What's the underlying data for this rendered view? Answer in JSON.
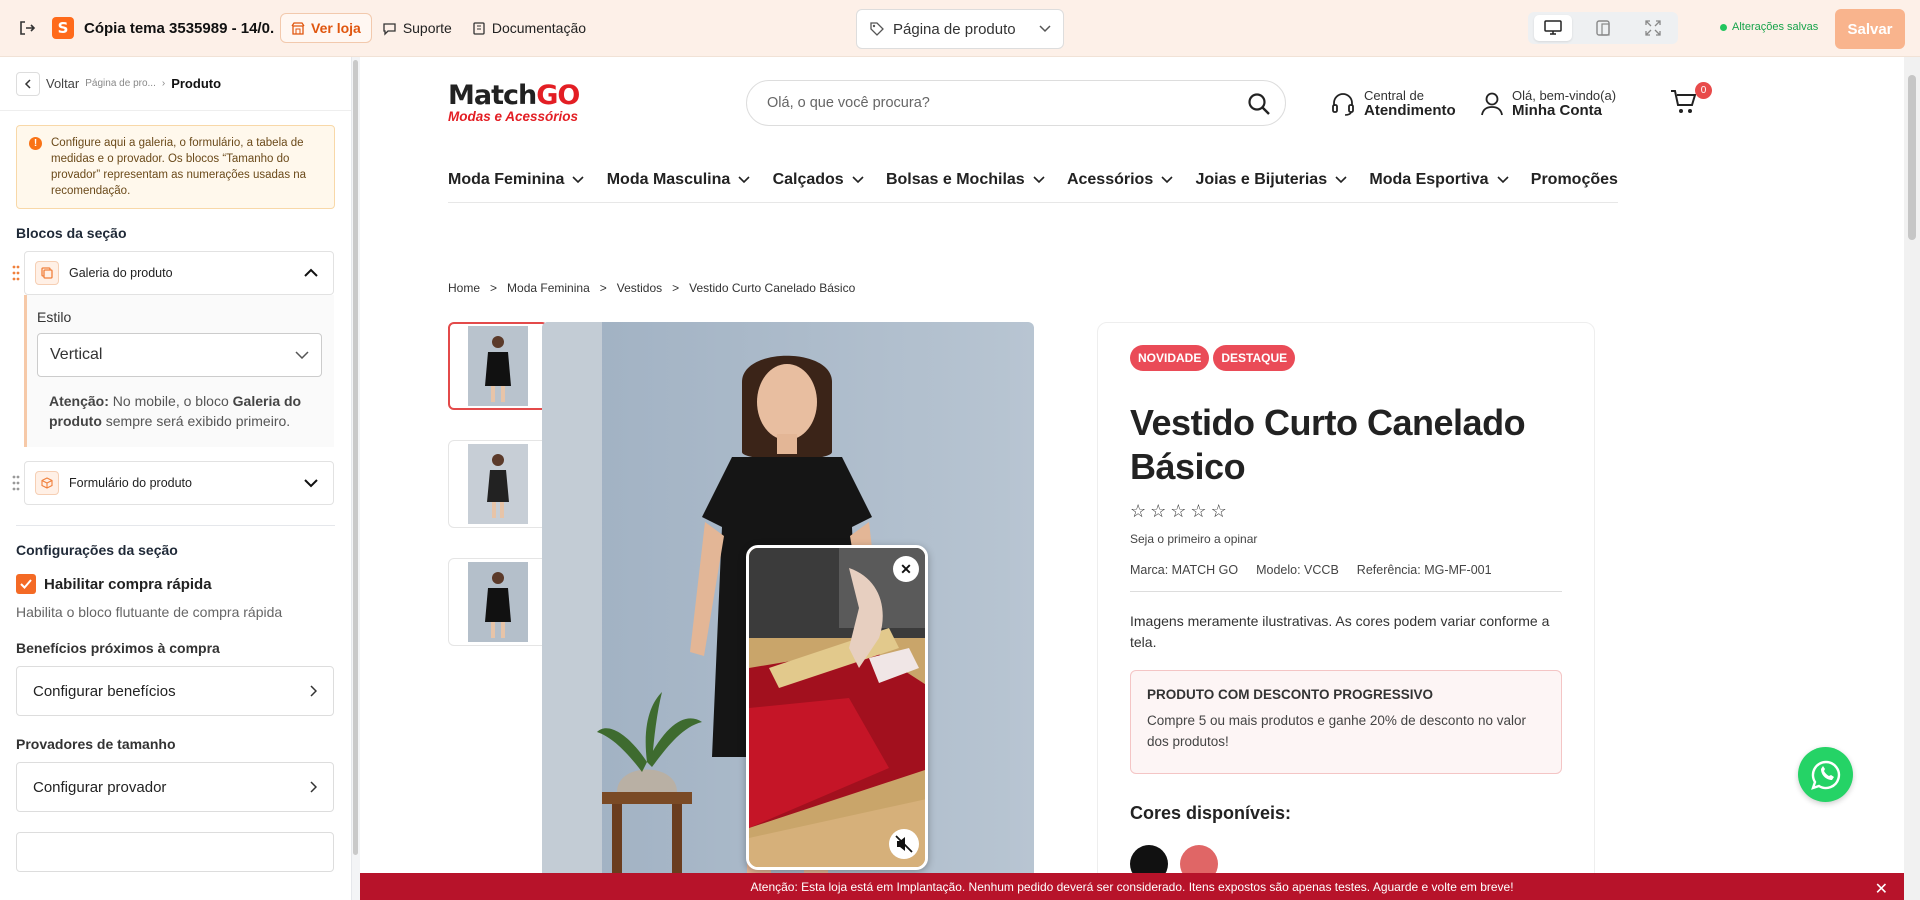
{
  "topbar": {
    "title": "Cópia tema 3535989 - 14/0...",
    "view_store": "Ver loja",
    "support": "Suporte",
    "docs": "Documentação",
    "page_select": "Página de produto",
    "saved_status": "Alterações salvas",
    "save_button": "Salvar",
    "accent_color": "#ff6a1a"
  },
  "sidebar": {
    "back": "Voltar",
    "crumb_parent": "Página de pro...",
    "crumb_sep": "›",
    "crumb_current": "Produto",
    "notice": "Configure aqui a galeria, o formulário, a tabela de medidas e o provador. Os blocos “Tamanho do provador” representam as numerações usadas na recomendação.",
    "blocks_heading": "Blocos da seção",
    "block_gallery": "Galeria do produto",
    "style_label": "Estilo",
    "style_value": "Vertical",
    "note_prefix": "Atenção:",
    "note_text1": " No mobile, o bloco ",
    "note_bold": "Galeria do produto",
    "note_text2": " sempre será exibido primeiro.",
    "block_form": "Formulário do produto",
    "config_heading": "Configurações da seção",
    "quick_buy_label": "Habilitar compra rápida",
    "quick_buy_checked": true,
    "quick_buy_help": "Habilita o bloco flutuante de compra rápida",
    "benefits_heading": "Benefícios próximos à compra",
    "benefits_button": "Configurar benefícios",
    "fitters_heading": "Provadores de tamanho",
    "fitters_button": "Configurar provador"
  },
  "store": {
    "logo_match": "Match",
    "logo_go": "GO",
    "logo_sub": "Modas e Acessórios",
    "search_placeholder": "Olá, o que você procura?",
    "support_line1": "Central de",
    "support_line2": "Atendimento",
    "account_line1": "Olá, bem-vindo(a)",
    "account_line2": "Minha Conta",
    "cart_count": "0",
    "nav": [
      "Moda Feminina",
      "Moda Masculina",
      "Calçados",
      "Bolsas e Mochilas",
      "Acessórios",
      "Joias e Bijuterias",
      "Moda Esportiva",
      "Promoções"
    ],
    "breadcrumb": [
      "Home",
      ">",
      "Moda Feminina",
      ">",
      "Vestidos",
      ">",
      "Vestido Curto Canelado Básico"
    ],
    "tags": [
      "NOVIDADE",
      "DESTAQUE"
    ],
    "product_title": "Vestido Curto Canelado Básico",
    "rating_stars": 0,
    "first_review": "Seja o primeiro a opinar",
    "brand": "Marca: MATCH GO",
    "model": "Modelo: VCCB",
    "reference": "Referência: MG-MF-001",
    "disclaimer": "Imagens meramente ilustrativas. As cores podem variar conforme a tela.",
    "promo_title": "PRODUTO COM DESCONTO PROGRESSIVO",
    "promo_text": "Compre 5 ou mais produtos e ganhe 20% de desconto no valor dos produtos!",
    "colors_heading": "Cores disponíveis:",
    "color_swatches": [
      "#111111",
      "#e06666"
    ],
    "alert": "Atenção: Esta loja está em Implantação. Nenhum pedido deverá ser considerado. Itens expostos são apenas testes. Aguarde e volte em breve!"
  }
}
